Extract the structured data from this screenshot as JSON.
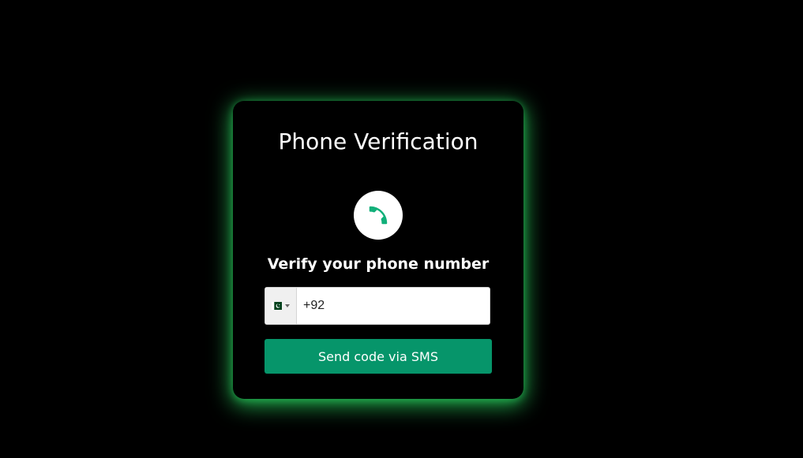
{
  "card": {
    "title": "Phone Verification",
    "subtitle": "Verify your phone number"
  },
  "icons": {
    "phone": "phone-icon",
    "flag": "pakistan-flag-icon",
    "dropdown": "caret-down-icon"
  },
  "phone_input": {
    "value": "+92",
    "country": "PK"
  },
  "send_button": {
    "label": "Send code via SMS"
  },
  "colors": {
    "background": "#000000",
    "glow": "#28c85a",
    "button": "#06956a",
    "phone_icon": "#12b07a"
  }
}
